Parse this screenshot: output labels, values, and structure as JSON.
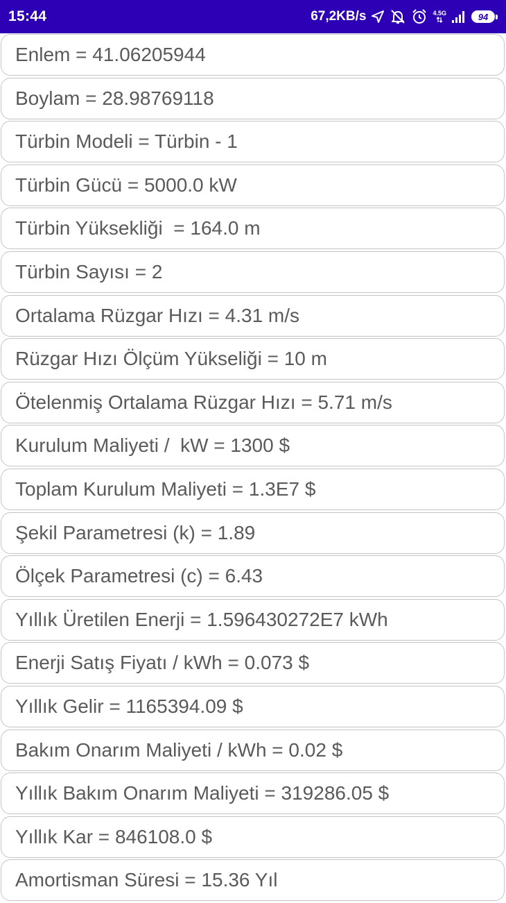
{
  "status_bar": {
    "time": "15:44",
    "net_speed": "67,2KB/s",
    "net_type": "4.5G",
    "battery": "94",
    "icons": [
      "location-arrow-icon",
      "bell-off-icon",
      "alarm-clock-icon",
      "signal-icon",
      "battery-icon"
    ],
    "background_color": "#2e00b5"
  },
  "rows": [
    "Enlem = 41.06205944",
    "Boylam = 28.98769118",
    "Türbin Modeli = Türbin - 1",
    "Türbin Gücü = 5000.0 kW",
    "Türbin Yüksekliği  = 164.0 m",
    "Türbin Sayısı = 2",
    "Ortalama Rüzgar Hızı = 4.31 m/s",
    "Rüzgar Hızı Ölçüm Yükseliği = 10 m",
    "Ötelenmiş Ortalama Rüzgar Hızı = 5.71 m/s",
    "Kurulum Maliyeti /  kW = 1300 $",
    "Toplam Kurulum Maliyeti = 1.3E7 $",
    "Şekil Parametresi (k) = 1.89",
    "Ölçek Parametresi (c) = 6.43",
    "Yıllık Üretilen Enerji = 1.596430272E7 kWh",
    "Enerji Satış Fiyatı / kWh = 0.073 $",
    "Yıllık Gelir = 1165394.09 $",
    "Bakım Onarım Maliyeti / kWh = 0.02 $",
    "Yıllık Bakım Onarım Maliyeti = 319286.05 $",
    "Yıllık Kar = 846108.0 $",
    "Amortisman Süresi = 15.36 Yıl"
  ]
}
